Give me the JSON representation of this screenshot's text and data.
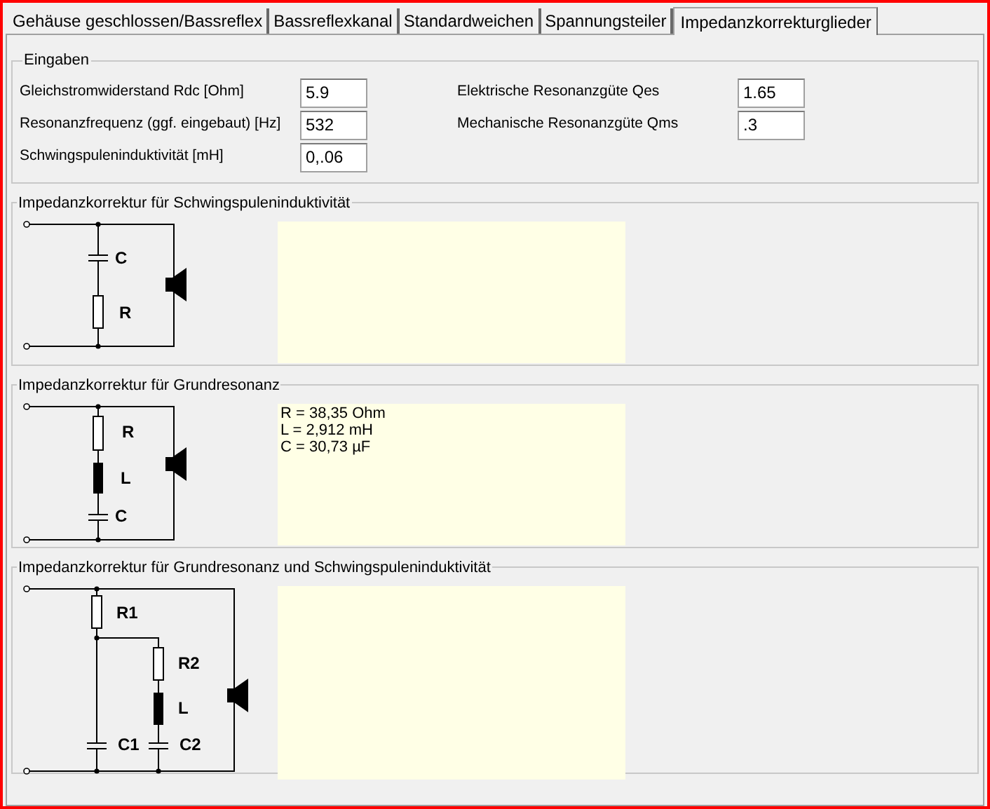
{
  "tabs": [
    {
      "label": "Gehäuse geschlossen/Bassreflex",
      "selected": false
    },
    {
      "label": "Bassreflexkanal",
      "selected": false
    },
    {
      "label": "Standardweichen",
      "selected": false
    },
    {
      "label": "Spannungsteiler",
      "selected": false
    },
    {
      "label": "Impedanzkorrekturglieder",
      "selected": true
    }
  ],
  "inputs": {
    "title": "Eingaben",
    "left_fields": [
      {
        "label": "Gleichstromwiderstand Rdc [Ohm]",
        "value": "5.9"
      },
      {
        "label": "Resonanzfrequenz (ggf. eingebaut) [Hz]",
        "value": "532"
      },
      {
        "label": "Schwingspuleninduktivität [mH]",
        "value": "0,.06"
      }
    ],
    "right_fields": [
      {
        "label": "Elektrische Resonanzgüte Qes",
        "value": "1.65"
      },
      {
        "label": "Mechanische Resonanzgüte Qms",
        "value": ".3"
      }
    ]
  },
  "sections": [
    {
      "title": "Impedanzkorrektur für Schwingspuleninduktivität",
      "kind": "inductance",
      "labels": [
        "C",
        "R"
      ]
    },
    {
      "title": "Impedanzkorrektur für Grundresonanz",
      "kind": "resonance",
      "labels": [
        "R",
        "L",
        "C"
      ],
      "result_lines": [
        "R = 38,35 Ohm",
        "L = 2,912 mH",
        "C = 30,73 µF"
      ]
    },
    {
      "title": "Impedanzkorrektur für Grundresonanz und Schwingspuleninduktivität",
      "kind": "combined",
      "labels": [
        "R1",
        "R2",
        "L",
        "C1",
        "C2"
      ]
    }
  ]
}
